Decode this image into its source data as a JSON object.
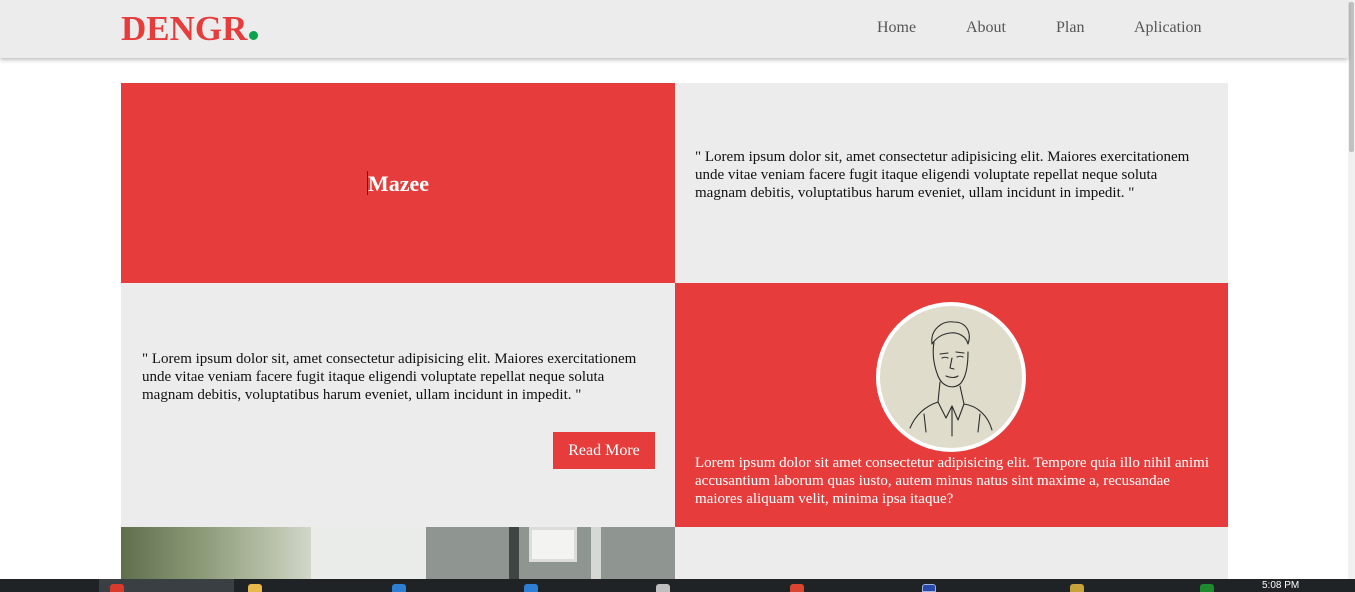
{
  "header": {
    "logo": "DENGR",
    "nav": [
      "Home",
      "About",
      "Plan",
      "Aplication"
    ]
  },
  "grid": {
    "title_card": {
      "title": "Mazee"
    },
    "quote_right": "\" Lorem ipsum dolor sit, amet consectetur adipisicing elit. Maiores exercitationem unde vitae veniam facere fugit itaque eligendi voluptate repellat neque soluta magnam debitis, voluptatibus harum eveniet, ullam incidunt in impedit. \"",
    "quote_left": "\" Lorem ipsum dolor sit, amet consectetur adipisicing elit. Maiores exercitationem unde vitae veniam facere fugit itaque eligendi voluptate repellat neque soluta magnam debitis, voluptatibus harum eveniet, ullam incidunt in impedit. \"",
    "read_more": "Read More",
    "profile_text": "Lorem ipsum dolor sit amet consectetur adipisicing elit. Tempore quia illo nihil animi accusantium laborum quas iusto, autem minus natus sint maxime a, recusandae maiores aliquam velit, minima ipsa itaque?"
  },
  "taskbar": {
    "time": "5:08 PM"
  },
  "colors": {
    "accent": "#e63c3c",
    "panel": "#ececec",
    "logo_dot": "#0aa24b"
  }
}
